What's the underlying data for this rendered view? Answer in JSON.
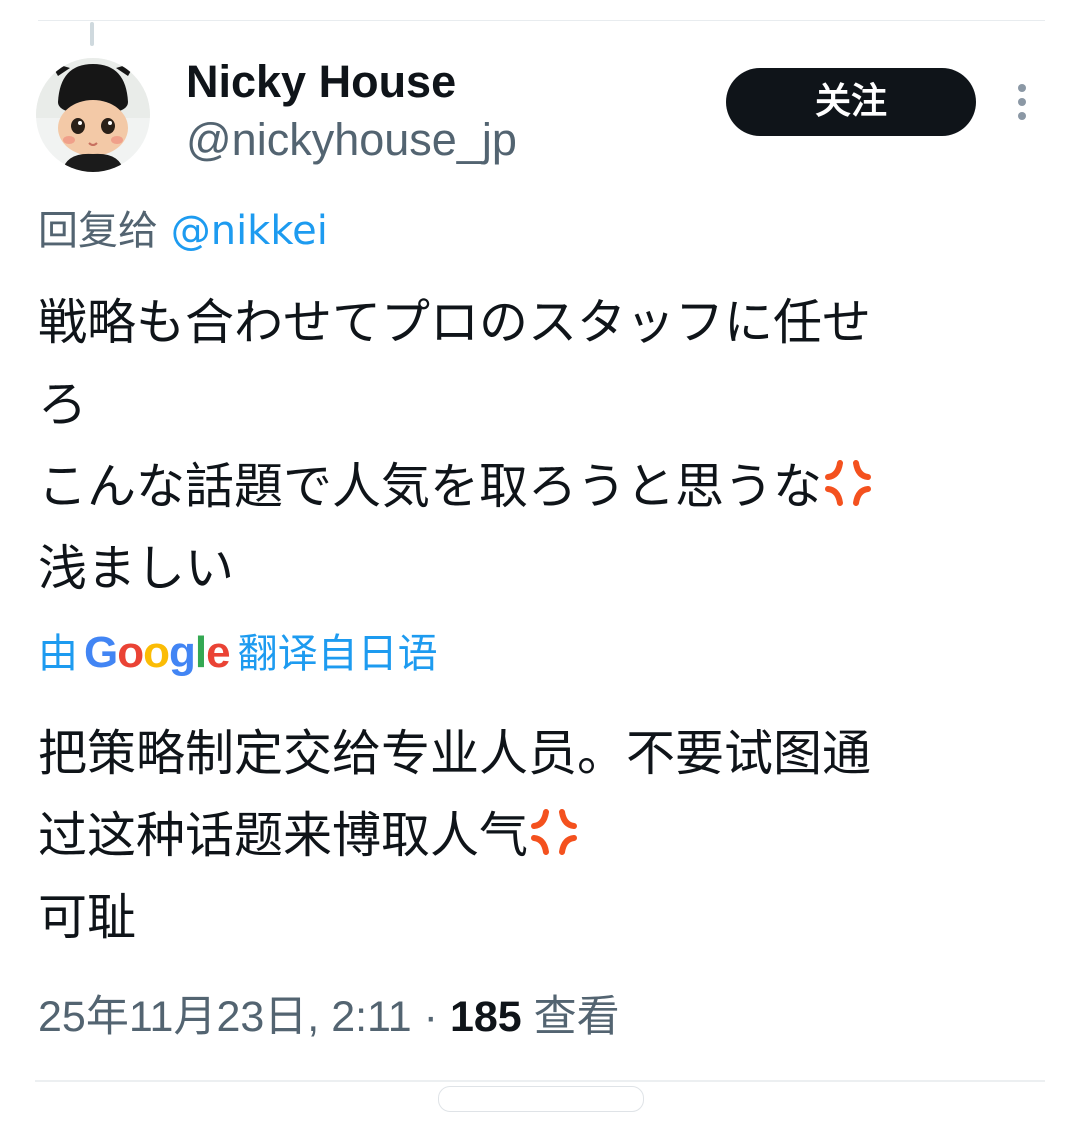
{
  "author": {
    "display_name": "Nicky House",
    "handle": "@nickyhouse_jp",
    "avatar_alt": "avatar"
  },
  "follow_button": {
    "label": "关注"
  },
  "more_menu": {
    "icon": "more-vertical-icon"
  },
  "reply_context": {
    "prefix": "回复给",
    "mention": "@nikkei"
  },
  "tweet": {
    "lines": [
      "戦略も合わせてプロのスタッフに任せ",
      "ろ",
      "こんな話題で人気を取ろうと思うな",
      "浅ましい"
    ],
    "emoji": "anger-symbol-icon"
  },
  "translation": {
    "prefix": "由",
    "provider": "Google",
    "suffix": "翻译自日语",
    "lines": [
      "把策略制定交给专业人员。不要试图通",
      "过这种话题来博取人气",
      "可耻"
    ]
  },
  "meta": {
    "timestamp": "25年11月23日, 2:11",
    "separator": "·",
    "views_count": "185",
    "views_label": "查看"
  },
  "colors": {
    "text_primary": "#0f1419",
    "text_secondary": "#536471",
    "link_blue": "#1d9bf0",
    "anger_red": "#f4511e",
    "google_blue": "#4285f4",
    "google_red": "#ea4335",
    "google_yellow": "#fbbc05",
    "google_green": "#34a853"
  }
}
